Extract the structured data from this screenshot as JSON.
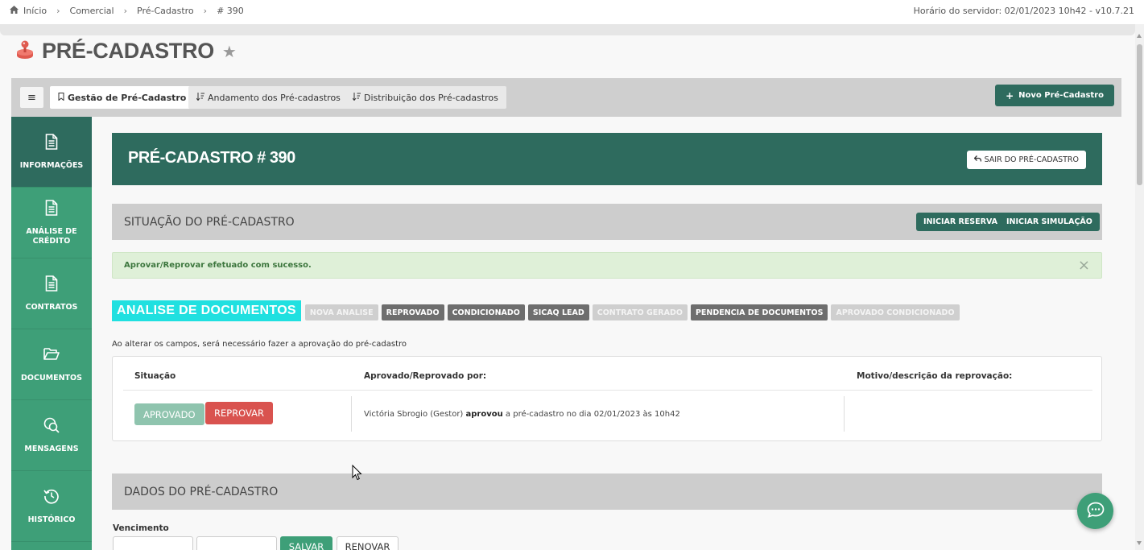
{
  "breadcrumb": {
    "items": [
      "Início",
      "Comercial",
      "Pré-Cadastro",
      "# 390"
    ]
  },
  "server_info": "Horário do servidor: 02/01/2023 10h42 - v10.7.21",
  "page": {
    "title": "PRÉ-CADASTRO",
    "icon": "joystick-icon",
    "accent": "#e05a4f"
  },
  "tabs": {
    "menu_icon": "hamburger-icon",
    "items": [
      {
        "label": "Gestão de Pré-Cadastro",
        "icon": "bookmark-icon",
        "active": true
      },
      {
        "label": "Andamento dos Pré-cadastros",
        "icon": "sort-icon",
        "active": false
      },
      {
        "label": "Distribuição dos Pré-cadastros",
        "icon": "sort-icon",
        "active": false
      }
    ],
    "new_button": "Novo Pré-Cadastro"
  },
  "sidebar": {
    "items": [
      {
        "label": "INFORMAÇÕES",
        "icon": "file-text-icon",
        "active": true
      },
      {
        "label": "ANÁLISE DE CRÉDITO",
        "icon": "file-text-icon",
        "active": false
      },
      {
        "label": "CONTRATOS",
        "icon": "file-text-icon",
        "active": false
      },
      {
        "label": "DOCUMENTOS",
        "icon": "folder-open-icon",
        "active": false
      },
      {
        "label": "MENSAGENS",
        "icon": "search-chat-icon",
        "active": false
      },
      {
        "label": "HISTÓRICO",
        "icon": "history-icon",
        "active": false
      }
    ]
  },
  "header": {
    "title": "PRÉ-CADASTRO # 390",
    "exit_button": "SAIR DO PRÉ-CADASTRO"
  },
  "status_section": {
    "title": "SITUAÇÃO DO PRÉ-CADASTRO",
    "buttons": [
      "INICIAR RESERVA",
      "INICIAR SIMULAÇÃO"
    ]
  },
  "alert": {
    "message": "Aprovar/Reprovar efetuado com sucesso.",
    "close": "×"
  },
  "analysis": {
    "title": "ANALISE DE DOCUMENTOS",
    "chips": [
      {
        "label": "NOVA ANALISE",
        "style": "light"
      },
      {
        "label": "REPROVADO",
        "style": "dark"
      },
      {
        "label": "CONDICIONADO",
        "style": "dark"
      },
      {
        "label": "SICAQ LEAD",
        "style": "dark"
      },
      {
        "label": "CONTRATO GERADO",
        "style": "light"
      },
      {
        "label": "PENDENCIA DE DOCUMENTOS",
        "style": "dark"
      },
      {
        "label": "APROVADO CONDICIONADO",
        "style": "light"
      }
    ]
  },
  "note": "Ao alterar os campos, será necessário fazer a aprovação do pré-cadastro",
  "approval_table": {
    "col_status": "Situação",
    "col_by": "Aprovado/Reprovado por:",
    "col_reason": "Motivo/descrição da reprovação:",
    "approved_button": "APROVADO",
    "reject_button": "REPROVAR",
    "who_prefix": "Victória Sbrogio (Gestor)",
    "who_action": "aprovou",
    "who_suffix": "a pré-cadastro no dia 02/01/2023 às 10h42",
    "reason": ""
  },
  "data_section": {
    "title": "DADOS DO PRÉ-CADASTRO",
    "vencimento_label": "Vencimento",
    "save_button": "SALVAR",
    "renew_button": "RENOVAR"
  },
  "colors": {
    "primary_dark": "#2e6b5e",
    "primary": "#3e9f78",
    "danger": "#d9534f",
    "accent_cyan": "#20e0e0"
  }
}
